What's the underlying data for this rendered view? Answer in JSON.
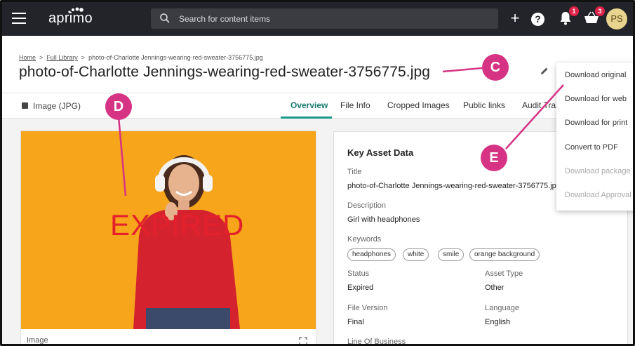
{
  "app": {
    "logo_text": "aprimo"
  },
  "search": {
    "placeholder": "Search for content items"
  },
  "notifications": {
    "count": "1"
  },
  "cart": {
    "count": "3"
  },
  "user": {
    "initials": "PS"
  },
  "breadcrumb": {
    "home": "Home",
    "library": "Full Library",
    "current": "photo-of-Charlotte Jennings-wearing-red-sweater-3756775.jpg"
  },
  "page": {
    "title": "photo-of-Charlotte Jennings-wearing-red-sweater-3756775.jpg"
  },
  "asset_type": "Image (JPG)",
  "tabs": [
    {
      "label": "Overview"
    },
    {
      "label": "File Info"
    },
    {
      "label": "Cropped Images"
    },
    {
      "label": "Public links"
    },
    {
      "label": "Audit Trai"
    }
  ],
  "image_card": {
    "overlay_text": "EXPIRED",
    "caption": "Image"
  },
  "key_asset_data": {
    "heading": "Key Asset Data",
    "title_label": "Title",
    "title_value": "photo-of-Charlotte Jennings-wearing-red-sweater-3756775.jpg",
    "description_label": "Description",
    "description_value": "Girl with headphones",
    "keywords_label": "Keywords",
    "keywords": [
      "headphones",
      "white",
      "smile",
      "orange background"
    ],
    "status_label": "Status",
    "status_value": "Expired",
    "asset_type_label": "Asset Type",
    "asset_type_value": "Other",
    "file_version_label": "File Version",
    "file_version_value": "Final",
    "language_label": "Language",
    "language_value": "English",
    "line_of_business_label": "Line Of Business"
  },
  "download_menu": {
    "items": [
      {
        "label": "Download original",
        "enabled": true
      },
      {
        "label": "Download for web",
        "enabled": true
      },
      {
        "label": "Download for print",
        "enabled": true
      },
      {
        "label": "Convert to PDF",
        "enabled": true
      },
      {
        "label": "Download package",
        "enabled": false
      },
      {
        "label": "Download Approval",
        "enabled": false
      }
    ]
  },
  "annotations": {
    "c": "C",
    "d": "D",
    "e": "E"
  },
  "colors": {
    "topbar": "#222429",
    "accent": "#1b9a8c",
    "callout": "#d63384",
    "photo_bg": "#f7a51a",
    "expired": "#e4202d"
  }
}
